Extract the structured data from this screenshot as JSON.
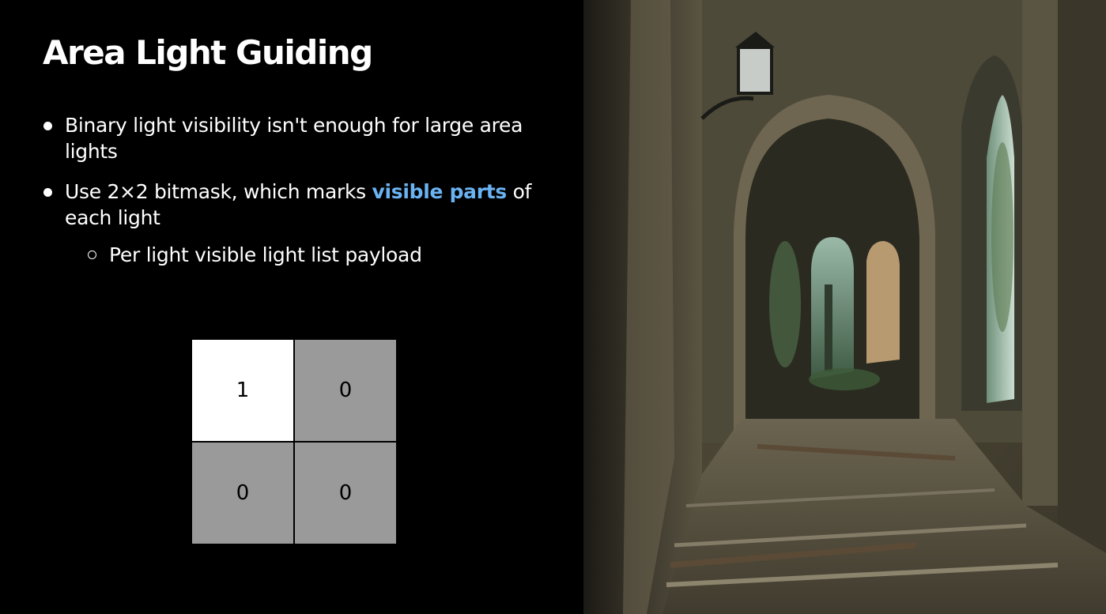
{
  "slide": {
    "title": "Area Light Guiding",
    "bullets": [
      {
        "text_before": "Binary light visibility isn't enough for large area lights"
      },
      {
        "text_before": "Use 2×2 bitmask, which marks ",
        "highlight": "visible parts",
        "text_after": " of each light"
      }
    ],
    "sub_bullet": "Per light visible light list payload",
    "bitmask": [
      "1",
      "0",
      "0",
      "0"
    ],
    "bitmask_on": [
      true,
      false,
      false,
      false
    ],
    "colors": {
      "background": "#000000",
      "text": "#ffffff",
      "highlight": "#6ab3f2",
      "cell_on": "#ffffff",
      "cell_off": "#9a9a9a"
    }
  }
}
